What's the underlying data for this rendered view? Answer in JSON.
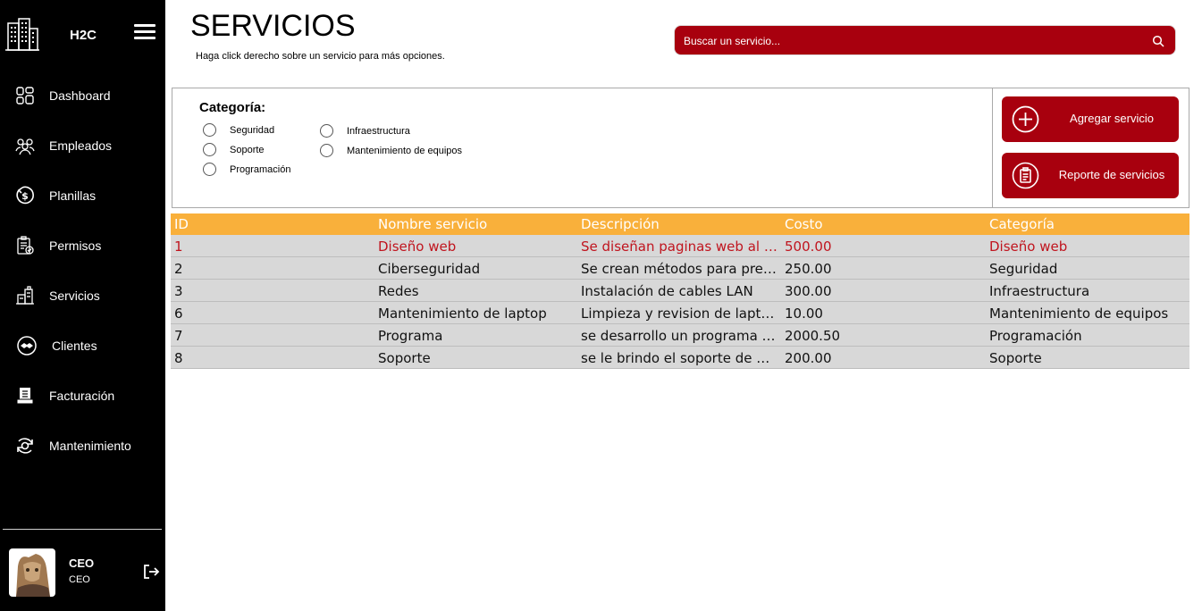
{
  "app": {
    "brand": "H2C"
  },
  "sidebar": {
    "items": [
      {
        "label": "Dashboard",
        "icon": "dashboard-icon"
      },
      {
        "label": "Empleados",
        "icon": "employees-icon"
      },
      {
        "label": "Planillas",
        "icon": "payroll-icon"
      },
      {
        "label": "Permisos",
        "icon": "permissions-icon"
      },
      {
        "label": "Servicios",
        "icon": "services-icon"
      },
      {
        "label": "Clientes",
        "icon": "handshake-icon"
      },
      {
        "label": "Facturación",
        "icon": "invoice-icon"
      },
      {
        "label": "Mantenimiento",
        "icon": "maintenance-icon"
      }
    ],
    "user": {
      "name": "CEO",
      "role": "CEO"
    }
  },
  "header": {
    "title": "SERVICIOS",
    "subtitle": "Haga click derecho sobre un servicio para más opciones.",
    "search_placeholder": "Buscar un servicio..."
  },
  "filters": {
    "title": "Categoría:",
    "options": [
      "Seguridad",
      "Soporte",
      "Programación",
      "Infraestructura",
      "Mantenimiento de equipos"
    ]
  },
  "actions": {
    "add_label": "Agregar servicio",
    "report_label": "Reporte de servicios"
  },
  "table": {
    "columns": [
      "ID",
      "Nombre servicio",
      "Descripción",
      "Costo",
      "Categoría"
    ],
    "rows": [
      [
        "1",
        "Diseño web",
        "Se diseñan paginas web al gusto del cliente",
        "500.00",
        "Diseño web"
      ],
      [
        "2",
        "Ciberseguridad",
        "Se crean métodos para prevenir ataques",
        "250.00",
        "Seguridad"
      ],
      [
        "3",
        "Redes",
        "Instalación de cables LAN",
        "300.00",
        "Infraestructura"
      ],
      [
        "6",
        "Mantenimiento de laptop",
        "Limpieza y revision de laptops",
        "10.00",
        "Mantenimiento de equipos"
      ],
      [
        "7",
        "Programa",
        "se desarrollo un programa de escritorio",
        "2000.50",
        "Programación"
      ],
      [
        "8",
        "Soporte",
        "se le brindo el soporte de un equipo",
        "200.00",
        "Soporte"
      ]
    ],
    "selected_row": 0
  },
  "colors": {
    "sidebar_bg": "#000000",
    "accent_red": "#a8000e",
    "header_orange": "#f9b03b",
    "row_bg": "#d8d8d8",
    "selected_text": "#c0141e"
  }
}
